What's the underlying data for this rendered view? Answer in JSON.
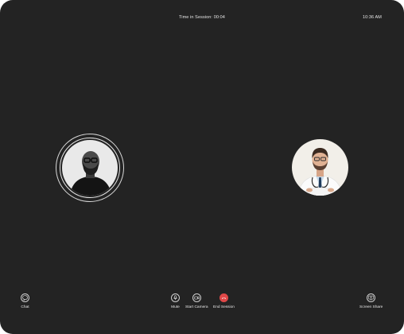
{
  "header": {
    "session_timer": "Time in Session: 00:04",
    "clock": "10:36 AM"
  },
  "participants": {
    "local": {
      "ring_color": "#d9d9d9"
    },
    "remote": {
      "background": "#f2efe9"
    }
  },
  "controls": {
    "chat_label": "Chat",
    "mute_label": "Mute",
    "start_camera_label": "Start Camera",
    "end_session_label": "End Session",
    "screen_share_label": "Screen Share"
  },
  "colors": {
    "background": "#232323",
    "end_session": "#e04848"
  }
}
